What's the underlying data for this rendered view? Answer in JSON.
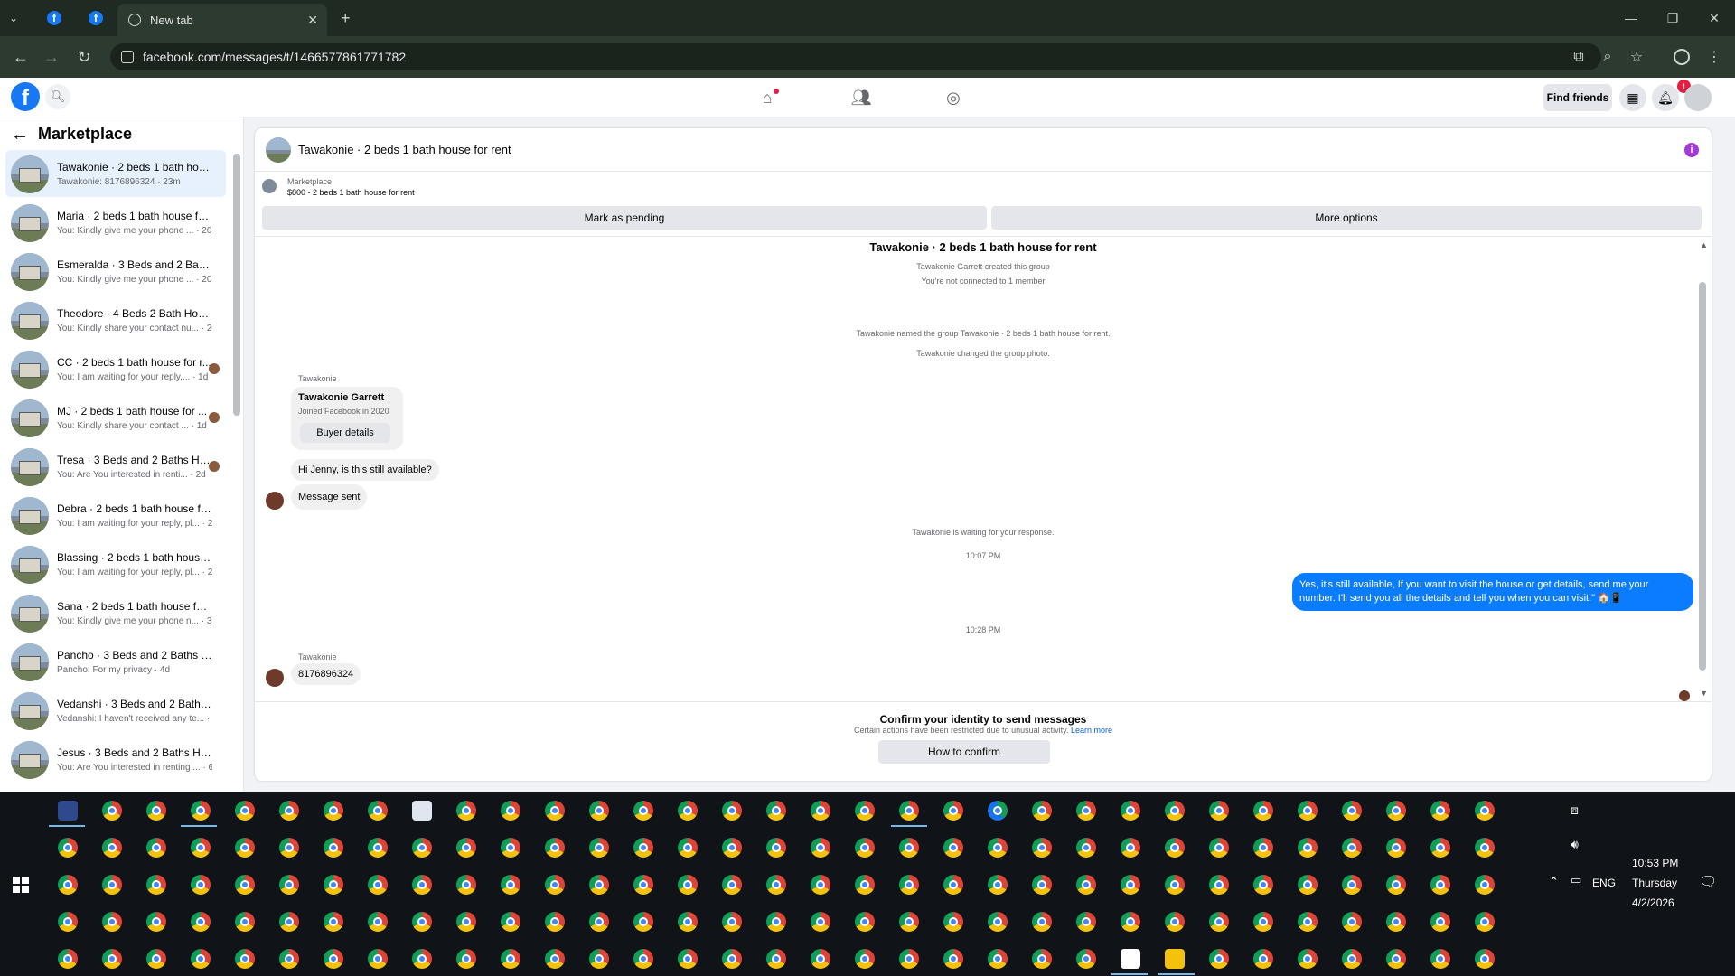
{
  "browser": {
    "tabs": [
      {
        "label": "",
        "icon": "facebook-icon"
      },
      {
        "label": "",
        "icon": "facebook-icon"
      },
      {
        "label": "New tab",
        "icon": "globe-icon"
      }
    ],
    "url": "facebook.com/messages/t/1466577861771782"
  },
  "fb_header": {
    "find_friends": "Find friends",
    "notification_count": "1"
  },
  "left_panel": {
    "title": "Marketplace",
    "conversations": [
      {
        "name": "Tawakonie · 2 beds 1 bath hous...",
        "preview": "Tawakonie: 8176896324 · 23m",
        "active": true,
        "mini_avatar": false
      },
      {
        "name": "Maria · 2 beds 1 bath house for ...",
        "preview": "You: Kindly give me your phone ... · 20h",
        "active": false,
        "mini_avatar": false
      },
      {
        "name": "Esmeralda · 3 Beds and 2 Baths ...",
        "preview": "You: Kindly give me your phone ... · 20h",
        "active": false,
        "mini_avatar": false
      },
      {
        "name": "Theodore · 4 Beds 2 Bath Hous...",
        "preview": "You: Kindly share your contact nu... · 20h",
        "active": false,
        "mini_avatar": false
      },
      {
        "name": "CC · 2 beds 1 bath house for r...",
        "preview": "You: I am waiting for your reply,... · 1d",
        "active": false,
        "mini_avatar": true
      },
      {
        "name": "MJ · 2 beds 1 bath house for ...",
        "preview": "You: Kindly share your contact ... · 1d",
        "active": false,
        "mini_avatar": true
      },
      {
        "name": "Tresa · 3 Beds and 2 Baths Ho...",
        "preview": "You: Are You interested in renti... · 2d",
        "active": false,
        "mini_avatar": true
      },
      {
        "name": "Debra · 2 beds 1 bath house for...",
        "preview": "You: I am waiting for your reply, pl... · 2d",
        "active": false,
        "mini_avatar": false
      },
      {
        "name": "Blassing · 2 beds 1 bath house f...",
        "preview": "You: I am waiting for your reply, pl... · 2d",
        "active": false,
        "mini_avatar": false
      },
      {
        "name": "Sana · 2 beds 1 bath house for r...",
        "preview": "You: Kindly give me your phone n... · 3d",
        "active": false,
        "mini_avatar": false
      },
      {
        "name": "Pancho · 3 Beds and 2 Baths Ho...",
        "preview": "Pancho: For my privacy · 4d",
        "active": false,
        "mini_avatar": false
      },
      {
        "name": "Vedanshi · 3 Beds and 2 Baths ...",
        "preview": "Vedanshi: I haven't received any te... · 5d",
        "active": false,
        "mini_avatar": false
      },
      {
        "name": "Jesus · 3 Beds and 2 Baths Hous...",
        "preview": "You: Are You interested in renting ... · 6d",
        "active": false,
        "mini_avatar": false
      }
    ]
  },
  "chat": {
    "header_title": "Tawakonie · 2 beds 1 bath house for rent",
    "marketplace_label": "Marketplace",
    "listing": "$800 - 2 beds 1 bath house for rent",
    "mark_pending": "Mark as pending",
    "more_options": "More options",
    "group_title": "Tawakonie · 2 beds 1 bath house for rent",
    "created": "Tawakonie Garrett created this group",
    "connected": "You're not connected to 1 member",
    "named_group": "Tawakonie named the group Tawakonie · 2 beds 1 bath house for rent.",
    "changed_photo": "Tawakonie changed the group photo.",
    "sender1": "Tawakonie",
    "card_name": "Tawakonie Garrett",
    "card_sub": "Joined Facebook in 2020",
    "buyer_details": "Buyer details",
    "msg1": "Hi Jenny, is this still available?",
    "msg2": "Message sent",
    "waiting": "Tawakonie is waiting for your response.",
    "time1": "10:07 PM",
    "reply_line1": "Yes, it's still available, If you want to visit the house or get details, send me your",
    "reply_line2": "number. I'll send you all the details and tell you when you can visit.\" 🏠📱",
    "time2": "10:28 PM",
    "sender2": "Tawakonie",
    "msg3": "8176896324",
    "confirm_title": "Confirm your identity to send messages",
    "confirm_sub": "Certain actions have been restricted due to unusual activity.",
    "learn_more": "Learn more",
    "how_to_confirm": "How to confirm"
  },
  "taskbar": {
    "language": "ENG",
    "time": "10:53 PM",
    "day": "Thursday",
    "date": "4/2/2026"
  }
}
